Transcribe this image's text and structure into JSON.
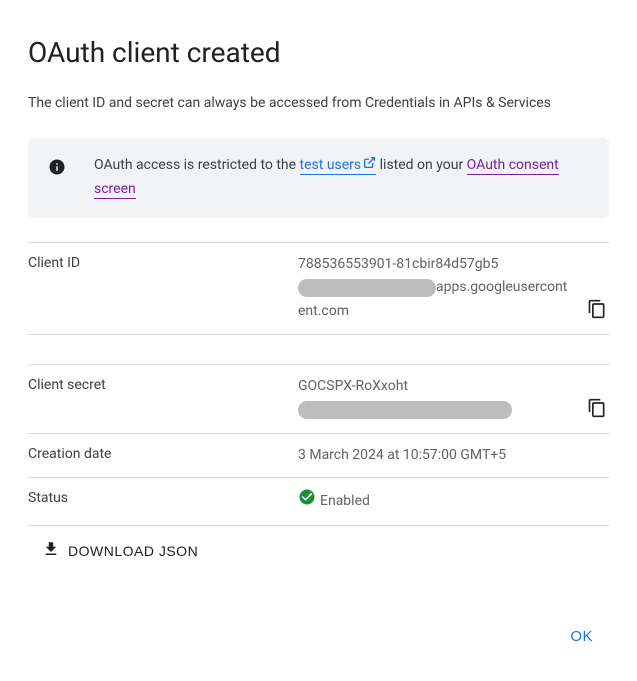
{
  "title": "OAuth client created",
  "subtitle": "The client ID and secret can always be accessed from Credentials in APIs & Services",
  "info": {
    "prefix": "OAuth access is restricted to the ",
    "link_test_users": "test users",
    "mid": " listed on your ",
    "link_consent": "OAuth consent screen"
  },
  "fields": {
    "client_id": {
      "label": "Client ID",
      "value_prefix": "788536553901-81cbir84d57gb5",
      "value_suffix": "apps.googleusercontent.com"
    },
    "client_secret": {
      "label": "Client secret",
      "value_prefix": "GOCSPX-RoXxoht"
    },
    "creation_date": {
      "label": "Creation date",
      "value": "3 March 2024 at 10:57:00 GMT+5"
    },
    "status": {
      "label": "Status",
      "value": "Enabled"
    }
  },
  "buttons": {
    "download": "DOWNLOAD JSON",
    "ok": "OK"
  }
}
